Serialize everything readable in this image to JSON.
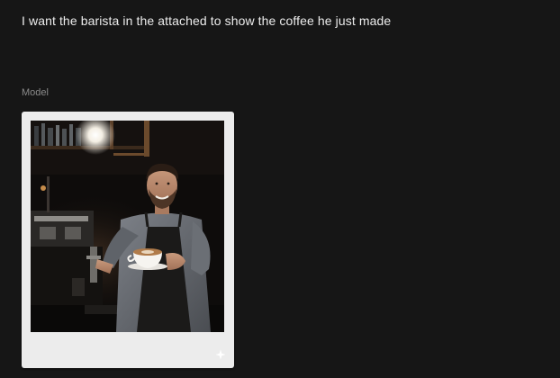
{
  "prompt": {
    "text": "I want the barista in the attached to show the coffee he just made"
  },
  "model": {
    "label": "Model"
  },
  "image_card": {
    "image_description_icon": "barista-photo",
    "badge_icon": "sparkle-icon"
  },
  "colors": {
    "background": "#161616",
    "card": "#ececec",
    "prompt_text": "#ececec",
    "label_text": "#8a8a8a"
  }
}
